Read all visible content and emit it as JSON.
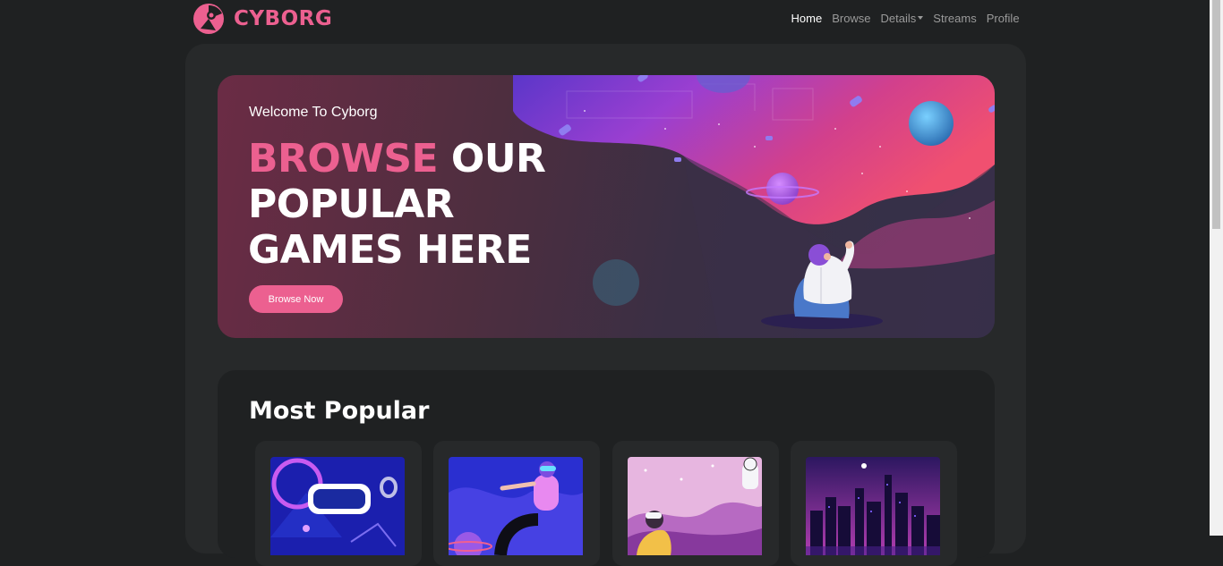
{
  "brand": {
    "name": "CYBORG",
    "accent": "#ec6090"
  },
  "nav": {
    "items": [
      {
        "label": "Home",
        "active": true
      },
      {
        "label": "Browse",
        "active": false
      },
      {
        "label": "Details",
        "active": false,
        "dropdown": true
      },
      {
        "label": "Streams",
        "active": false
      },
      {
        "label": "Profile",
        "active": false
      }
    ]
  },
  "banner": {
    "welcome": "Welcome To Cyborg",
    "heading_accent": "BROWSE",
    "heading_rest_1": " OUR",
    "heading_rest_2": "POPULAR",
    "heading_rest_3": "GAMES HERE",
    "button_label": "Browse Now"
  },
  "popular": {
    "title": "Most Popular",
    "cards": [
      {
        "theme": "vr-headset-neon"
      },
      {
        "theme": "vr-person-space"
      },
      {
        "theme": "vr-astronaut-pink"
      },
      {
        "theme": "neon-city-night"
      }
    ]
  }
}
